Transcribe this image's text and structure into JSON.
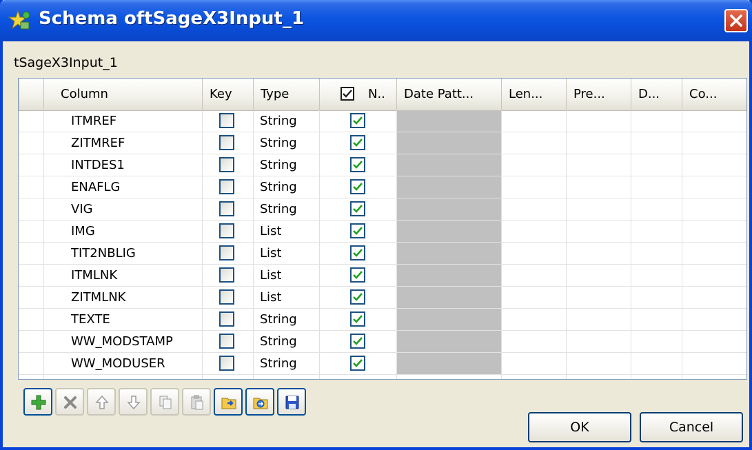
{
  "window": {
    "title": "Schema oftSageX3Input_1",
    "icon": "schema-star-icon"
  },
  "subtitle": "tSageX3Input_1",
  "table": {
    "headers": {
      "column": "Column",
      "key": "Key",
      "type": "Type",
      "nullable": "N..",
      "date_pattern": "Date Patt...",
      "length": "Len...",
      "precision": "Pre...",
      "default": "D...",
      "comment": "Co..."
    },
    "rows": [
      {
        "name": "ITMREF",
        "key": false,
        "type": "String",
        "nullable": true
      },
      {
        "name": "ZITMREF",
        "key": false,
        "type": "String",
        "nullable": true
      },
      {
        "name": "INTDES1",
        "key": false,
        "type": "String",
        "nullable": true
      },
      {
        "name": "ENAFLG",
        "key": false,
        "type": "String",
        "nullable": true
      },
      {
        "name": "VIG",
        "key": false,
        "type": "String",
        "nullable": true
      },
      {
        "name": "IMG",
        "key": false,
        "type": "List",
        "nullable": true
      },
      {
        "name": "TIT2NBLIG",
        "key": false,
        "type": "List",
        "nullable": true
      },
      {
        "name": "ITMLNK",
        "key": false,
        "type": "List",
        "nullable": true
      },
      {
        "name": "ZITMLNK",
        "key": false,
        "type": "List",
        "nullable": true
      },
      {
        "name": "TEXTE",
        "key": false,
        "type": "String",
        "nullable": true
      },
      {
        "name": "WW_MODSTAMP",
        "key": false,
        "type": "String",
        "nullable": true
      },
      {
        "name": "WW_MODUSER",
        "key": false,
        "type": "String",
        "nullable": true
      }
    ]
  },
  "toolbar": [
    {
      "name": "add-row-button",
      "icon": "plus-icon",
      "enabled": true
    },
    {
      "name": "remove-row-button",
      "icon": "x-icon",
      "enabled": false
    },
    {
      "name": "move-up-button",
      "icon": "arrow-up-icon",
      "enabled": false
    },
    {
      "name": "move-down-button",
      "icon": "arrow-down-icon",
      "enabled": false
    },
    {
      "name": "copy-button",
      "icon": "copy-icon",
      "enabled": false
    },
    {
      "name": "paste-button",
      "icon": "paste-icon",
      "enabled": false
    },
    {
      "name": "import-schema-button",
      "icon": "folder-import-icon",
      "enabled": true
    },
    {
      "name": "export-schema-button",
      "icon": "folder-export-icon",
      "enabled": true
    },
    {
      "name": "save-schema-button",
      "icon": "floppy-disk-icon",
      "enabled": true
    }
  ],
  "buttons": {
    "ok": "OK",
    "cancel": "Cancel"
  },
  "colors": {
    "titlebar": "#0A4CD6",
    "dialog_bg": "#ECE9D8",
    "check_green": "#21A121"
  }
}
